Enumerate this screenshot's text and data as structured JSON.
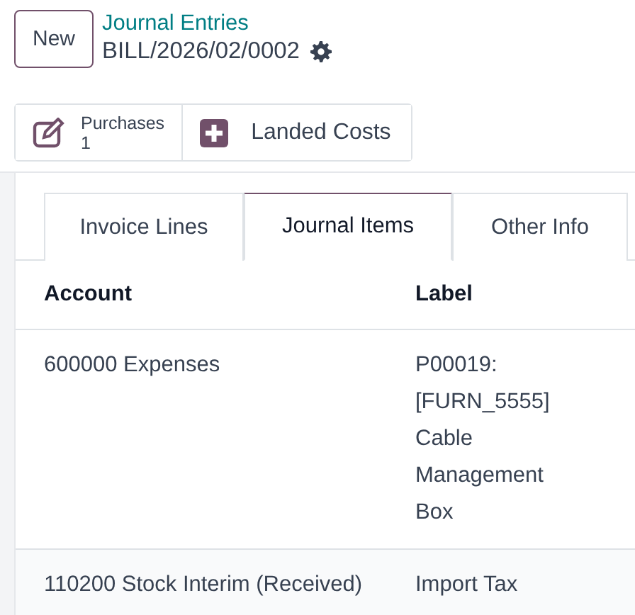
{
  "new_button": "New",
  "breadcrumb": {
    "parent": "Journal Entries",
    "record": "BILL/2026/02/0002"
  },
  "smart_buttons": [
    {
      "kind": "stat",
      "label": "Purchases",
      "value": "1"
    },
    {
      "kind": "action",
      "label": "Landed Costs"
    }
  ],
  "tabs": [
    {
      "label": "Invoice Lines",
      "selected": false
    },
    {
      "label": "Journal Items",
      "selected": true
    },
    {
      "label": "Other Info",
      "selected": false
    }
  ],
  "table": {
    "columns": [
      "Account",
      "Label"
    ],
    "rows": [
      {
        "account": "600000 Expenses",
        "label": "P00019: [FURN_5555] Cable Management Box"
      },
      {
        "account": "110200 Stock Interim (Received)",
        "label": "Import Tax"
      }
    ]
  }
}
